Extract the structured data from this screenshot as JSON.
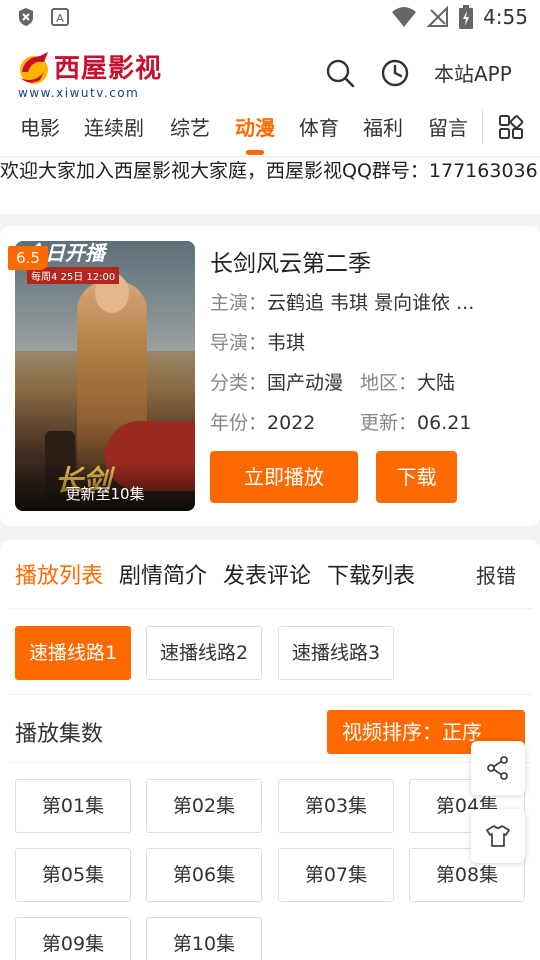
{
  "status_bar": {
    "time": "4:55"
  },
  "header": {
    "logo_cn": "西屋影视",
    "logo_en": "www.xiwutv.com",
    "app_link": "本站APP"
  },
  "nav": {
    "items": [
      "电影",
      "连续剧",
      "综艺",
      "动漫",
      "体育",
      "福利",
      "留言"
    ],
    "active": "动漫"
  },
  "notice": "欢迎大家加入西屋影视大家庭，西屋影视QQ群号：177163036",
  "detail": {
    "score": "6.5",
    "poster_title": "今日开播",
    "poster_date": "每周4 25日 12:00",
    "poster_name": "长剑",
    "poster_update": "更新至10集",
    "title": "长剑风云第二季",
    "cast_label": "主演：",
    "cast": "云鹤追 韦琪 景向谁依 ...",
    "director_label": "导演：",
    "director": "韦琪",
    "category_label": "分类：",
    "category": "国产动漫",
    "region_label": "地区：",
    "region": "大陆",
    "year_label": "年份：",
    "year": "2022",
    "update_label": "更新：",
    "update": "06.21",
    "play_button": "立即播放",
    "download_button": "下载"
  },
  "panel": {
    "tabs": [
      "播放列表",
      "剧情简介",
      "发表评论",
      "下载列表"
    ],
    "active_tab": "播放列表",
    "report": "报错",
    "routes": [
      "速播线路1",
      "速播线路2",
      "速播线路3"
    ],
    "active_route": "速播线路1",
    "episodes_title": "播放集数",
    "sort_button": "视频排序：正序",
    "episodes": [
      "第01集",
      "第02集",
      "第03集",
      "第04集",
      "第05集",
      "第06集",
      "第07集",
      "第08集",
      "第09集",
      "第10集"
    ]
  },
  "colors": {
    "accent": "#ff6a00",
    "logo_red": "#c8102e",
    "logo_blue": "#1a3d8f"
  },
  "icons": [
    "close-box-icon",
    "a-letter-icon",
    "wifi-icon",
    "no-signal-icon",
    "battery-icon",
    "search-icon",
    "history-clock-icon",
    "grid-icon",
    "share-icon",
    "tshirt-icon"
  ]
}
